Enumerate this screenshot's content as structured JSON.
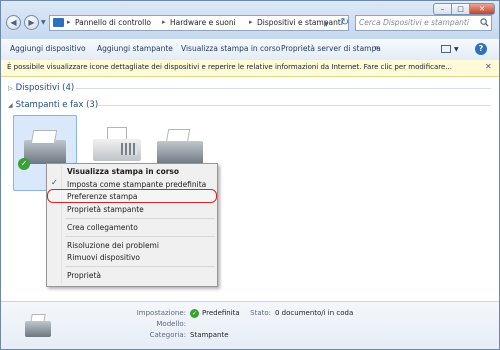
{
  "address_bar": {
    "crumbs": [
      "Pannello di controllo",
      "Hardware e suoni",
      "Dispositivi e stampanti"
    ],
    "search_placeholder": "Cerca Dispositivi e stampanti"
  },
  "command_bar": {
    "items": [
      "Aggiungi dispositivo",
      "Aggiungi stampante",
      "Visualizza stampa in corso",
      "Proprietà server di stampa"
    ],
    "more": "»"
  },
  "info_bar": {
    "text": "È possibile visualizzare icone dettagliate dei dispositivi e reperire le relative informazioni da Internet. Fare clic per modificare..."
  },
  "groups": {
    "devices": "Dispositivi (4)",
    "printers": "Stampanti e fax (3)"
  },
  "context_menu": {
    "items": [
      "Visualizza stampa in corso",
      "Imposta come stampante predefinita",
      "Preferenze stampa",
      "Proprietà stampante",
      "Crea collegamento",
      "Risoluzione dei problemi",
      "Rimuovi dispositivo",
      "Proprietà"
    ],
    "highlighted": "Preferenze stampa"
  },
  "details": {
    "setting_label": "Impostazione:",
    "setting_value": "Predefinita",
    "model_label": "Modello:",
    "model_value": "",
    "category_label": "Categoria:",
    "category_value": "Stampante",
    "status_label": "Stato:",
    "status_value": "0 documento/i in coda"
  }
}
